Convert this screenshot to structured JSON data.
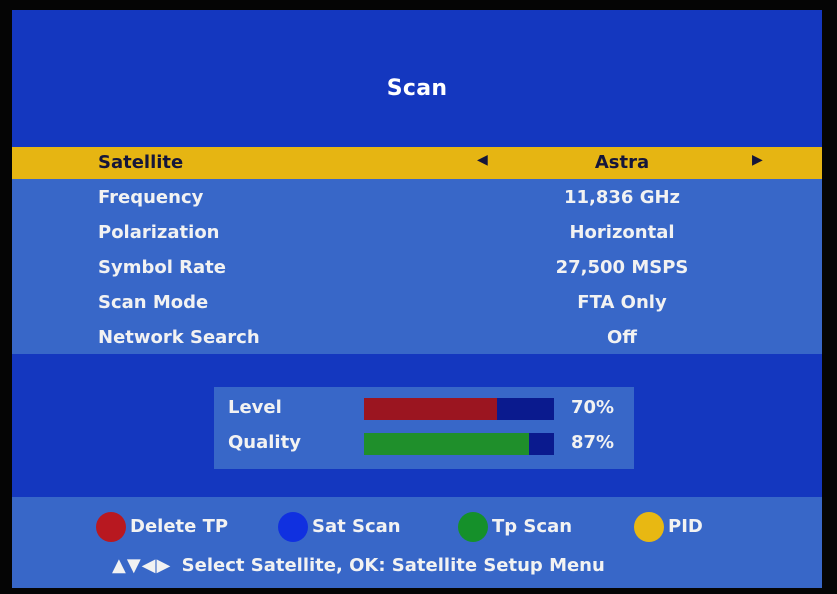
{
  "title": "Scan",
  "menu": {
    "rows": [
      {
        "label": "Satellite",
        "value": "Astra"
      },
      {
        "label": "Frequency",
        "value": "11,836 GHz"
      },
      {
        "label": "Polarization",
        "value": "Horizontal"
      },
      {
        "label": "Symbol Rate",
        "value": "27,500 MSPS"
      },
      {
        "label": "Scan Mode",
        "value": "FTA Only"
      },
      {
        "label": "Network Search",
        "value": "Off"
      }
    ],
    "selected_index": 0,
    "left_arrow": "◀",
    "right_arrow": "▶"
  },
  "signal": {
    "level": {
      "label": "Level",
      "percent_text": "70%",
      "fraction": 0.7,
      "color": "#9b1520"
    },
    "quality": {
      "label": "Quality",
      "percent_text": "87%",
      "fraction": 0.87,
      "color": "#1f8f2b"
    }
  },
  "footer": {
    "keys": [
      {
        "label": "Delete TP",
        "color": "#b81820"
      },
      {
        "label": "Sat Scan",
        "color": "#1030e0"
      },
      {
        "label": "Tp Scan",
        "color": "#15902a"
      },
      {
        "label": "PID",
        "color": "#e8b812"
      }
    ],
    "hint_arrows": "▲▼◀▶",
    "hint_text": "Select Satellite, OK: Satellite Setup Menu"
  }
}
